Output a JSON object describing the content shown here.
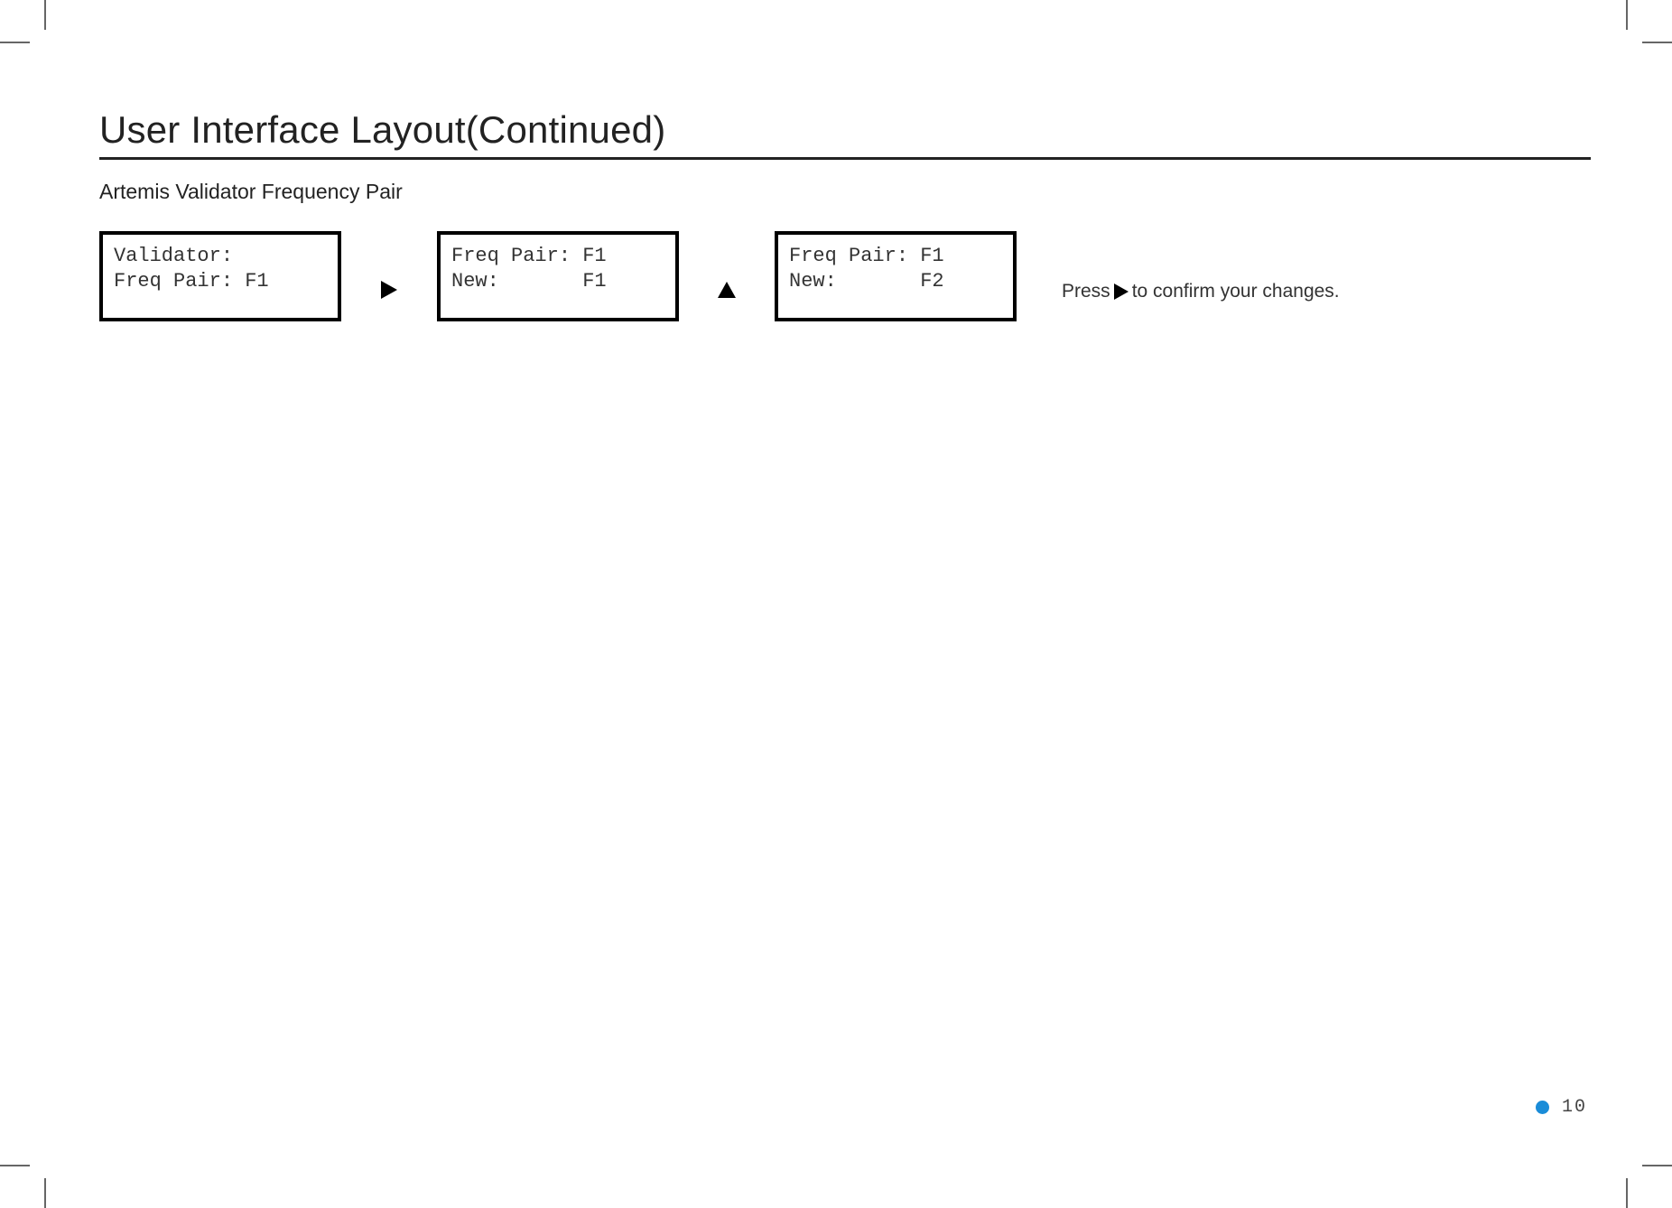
{
  "title": "User Interface Layout(Continued)",
  "subtitle": "Artemis Validator Frequency Pair",
  "screens": {
    "s1": "Validator:\nFreq Pair: F1",
    "s2": "Freq Pair: F1\nNew:       F1",
    "s3": "Freq Pair: F1\nNew:       F2"
  },
  "instruction": {
    "prefix": "Press ",
    "suffix": " to confirm your changes."
  },
  "page_number": "10"
}
